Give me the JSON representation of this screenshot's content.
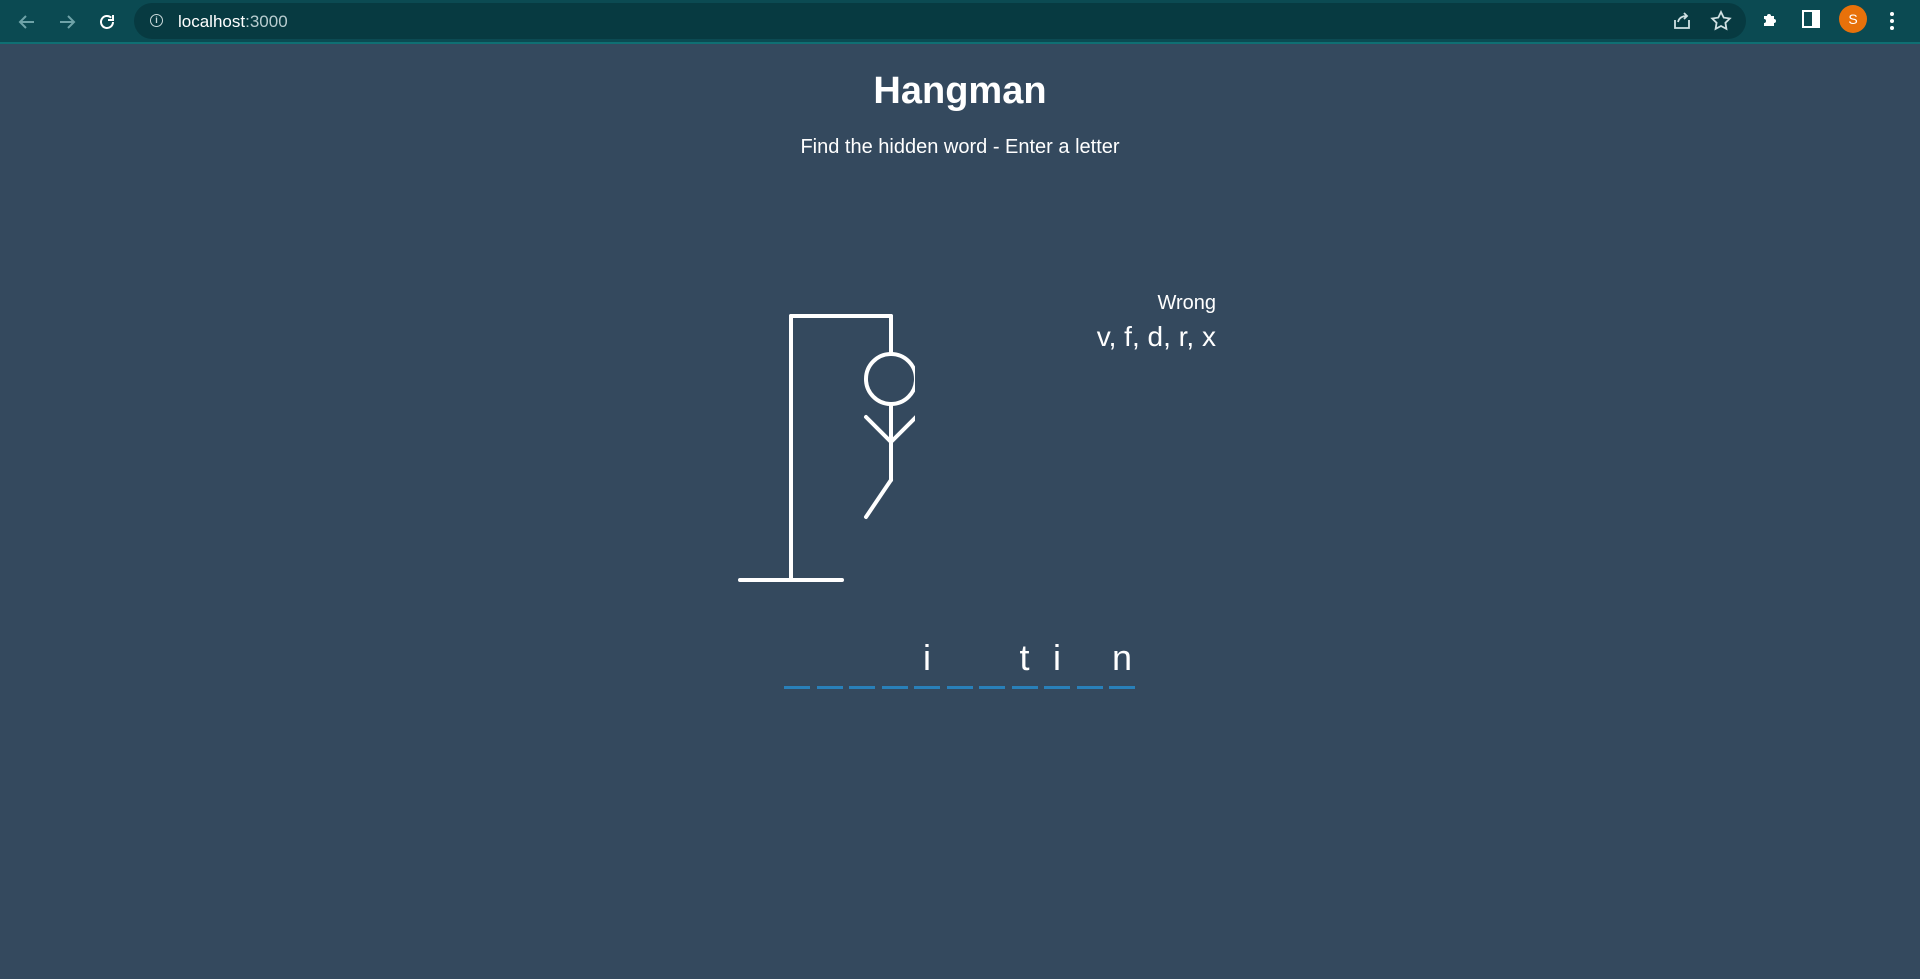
{
  "browser": {
    "url_host": "localhost",
    "url_port": ":3000",
    "profile_initial": "S"
  },
  "page": {
    "title": "Hangman",
    "subtitle": "Find the hidden word - Enter a letter"
  },
  "game": {
    "wrong_label": "Wrong",
    "wrong_letters_text": "v, f, d, r, x",
    "wrong_letters": [
      "v",
      "f",
      "d",
      "r",
      "x"
    ],
    "figure_parts_shown": [
      "head",
      "body",
      "left-arm",
      "right-arm",
      "left-leg"
    ],
    "word_slots": [
      "",
      "",
      "",
      "",
      "i",
      "",
      "",
      "t",
      "i",
      "",
      "n"
    ]
  },
  "colors": {
    "background": "#34495e",
    "underline": "#2980b9",
    "chrome": "#0b4a52",
    "avatar": "#e8710a"
  }
}
